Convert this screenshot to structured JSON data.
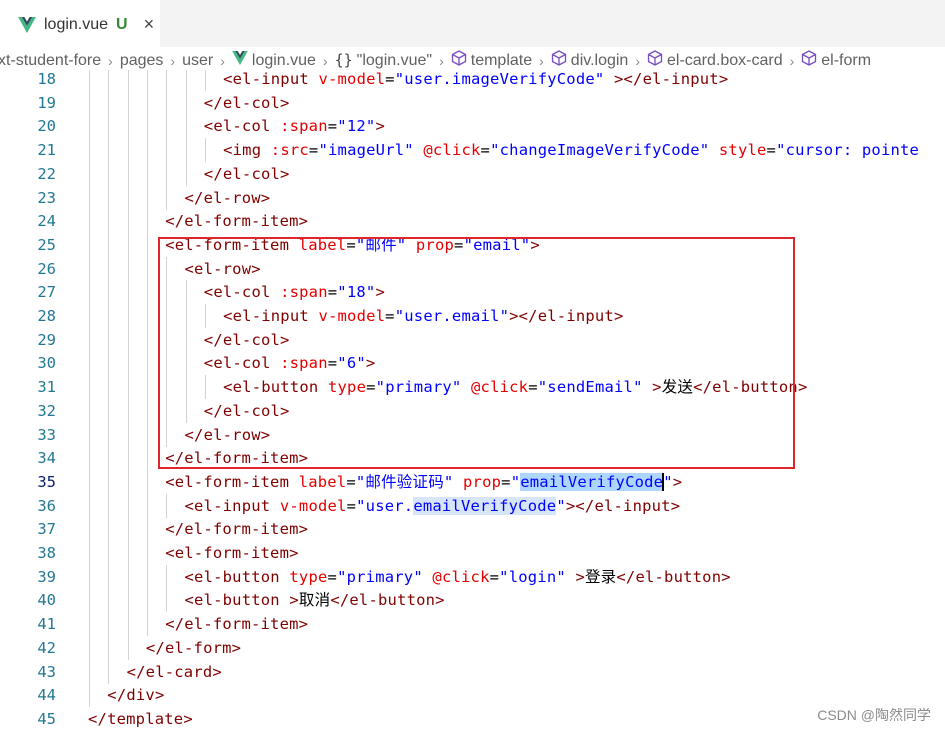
{
  "tab": {
    "title": "login.vue",
    "status": "U",
    "close": "×",
    "icon": "vue-icon"
  },
  "breadcrumb": [
    {
      "label": "xt-student-fore",
      "icon": ""
    },
    {
      "label": "pages",
      "icon": ""
    },
    {
      "label": "user",
      "icon": ""
    },
    {
      "label": "login.vue",
      "icon": "vue-icon"
    },
    {
      "label": "\"login.vue\"",
      "icon": "braces-icon"
    },
    {
      "label": "template",
      "icon": "cube-icon"
    },
    {
      "label": "div.login",
      "icon": "cube-icon"
    },
    {
      "label": "el-card.box-card",
      "icon": "cube-icon"
    },
    {
      "label": "el-form",
      "icon": "cube-icon"
    }
  ],
  "colors": {
    "tag": "#800000",
    "attr": "#e50000",
    "string": "#0000ff",
    "line_number": "#237893",
    "highlight": "#add6ff",
    "annotation_box": "#e1262b"
  },
  "active_line": "35",
  "lines": [
    {
      "n": "18",
      "indent": 7,
      "tokens": [
        {
          "t": "tag",
          "v": "<el-input"
        },
        {
          "t": "text",
          "v": " "
        },
        {
          "t": "attr",
          "v": "v-model"
        },
        {
          "t": "text",
          "v": "="
        },
        {
          "t": "str",
          "v": "\"user.imageVerifyCode\""
        },
        {
          "t": "text",
          "v": " "
        },
        {
          "t": "tag",
          "v": "></el-input>"
        }
      ]
    },
    {
      "n": "19",
      "indent": 6,
      "tokens": [
        {
          "t": "tag",
          "v": "</el-col>"
        }
      ]
    },
    {
      "n": "20",
      "indent": 6,
      "tokens": [
        {
          "t": "tag",
          "v": "<el-col"
        },
        {
          "t": "text",
          "v": " "
        },
        {
          "t": "attr",
          "v": ":span"
        },
        {
          "t": "text",
          "v": "="
        },
        {
          "t": "str",
          "v": "\"12\""
        },
        {
          "t": "tag",
          "v": ">"
        }
      ]
    },
    {
      "n": "21",
      "indent": 7,
      "tokens": [
        {
          "t": "tag",
          "v": "<img"
        },
        {
          "t": "text",
          "v": " "
        },
        {
          "t": "attr",
          "v": ":src"
        },
        {
          "t": "text",
          "v": "="
        },
        {
          "t": "str",
          "v": "\"imageUrl\""
        },
        {
          "t": "text",
          "v": " "
        },
        {
          "t": "attr",
          "v": "@click"
        },
        {
          "t": "text",
          "v": "="
        },
        {
          "t": "str",
          "v": "\"changeImageVerifyCode\""
        },
        {
          "t": "text",
          "v": " "
        },
        {
          "t": "attr",
          "v": "style"
        },
        {
          "t": "text",
          "v": "="
        },
        {
          "t": "str",
          "v": "\"cursor: pointe"
        }
      ]
    },
    {
      "n": "22",
      "indent": 6,
      "tokens": [
        {
          "t": "tag",
          "v": "</el-col>"
        }
      ]
    },
    {
      "n": "23",
      "indent": 5,
      "tokens": [
        {
          "t": "tag",
          "v": "</el-row>"
        }
      ]
    },
    {
      "n": "24",
      "indent": 4,
      "tokens": [
        {
          "t": "tag",
          "v": "</el-form-item>"
        }
      ]
    },
    {
      "n": "25",
      "indent": 4,
      "tokens": [
        {
          "t": "tag",
          "v": "<el-form-item"
        },
        {
          "t": "text",
          "v": " "
        },
        {
          "t": "attr",
          "v": "label"
        },
        {
          "t": "text",
          "v": "="
        },
        {
          "t": "str",
          "v": "\"邮件\""
        },
        {
          "t": "text",
          "v": " "
        },
        {
          "t": "attr",
          "v": "prop"
        },
        {
          "t": "text",
          "v": "="
        },
        {
          "t": "str",
          "v": "\"email\""
        },
        {
          "t": "tag",
          "v": ">"
        }
      ]
    },
    {
      "n": "26",
      "indent": 5,
      "tokens": [
        {
          "t": "tag",
          "v": "<el-row>"
        }
      ]
    },
    {
      "n": "27",
      "indent": 6,
      "tokens": [
        {
          "t": "tag",
          "v": "<el-col"
        },
        {
          "t": "text",
          "v": " "
        },
        {
          "t": "attr",
          "v": ":span"
        },
        {
          "t": "text",
          "v": "="
        },
        {
          "t": "str",
          "v": "\"18\""
        },
        {
          "t": "tag",
          "v": ">"
        }
      ]
    },
    {
      "n": "28",
      "indent": 7,
      "tokens": [
        {
          "t": "tag",
          "v": "<el-input"
        },
        {
          "t": "text",
          "v": " "
        },
        {
          "t": "attr",
          "v": "v-model"
        },
        {
          "t": "text",
          "v": "="
        },
        {
          "t": "str",
          "v": "\"user.email\""
        },
        {
          "t": "tag",
          "v": "></el-input>"
        }
      ]
    },
    {
      "n": "29",
      "indent": 6,
      "tokens": [
        {
          "t": "tag",
          "v": "</el-col>"
        }
      ]
    },
    {
      "n": "30",
      "indent": 6,
      "tokens": [
        {
          "t": "tag",
          "v": "<el-col"
        },
        {
          "t": "text",
          "v": " "
        },
        {
          "t": "attr",
          "v": ":span"
        },
        {
          "t": "text",
          "v": "="
        },
        {
          "t": "str",
          "v": "\"6\""
        },
        {
          "t": "tag",
          "v": ">"
        }
      ]
    },
    {
      "n": "31",
      "indent": 7,
      "tokens": [
        {
          "t": "tag",
          "v": "<el-button"
        },
        {
          "t": "text",
          "v": " "
        },
        {
          "t": "attr",
          "v": "type"
        },
        {
          "t": "text",
          "v": "="
        },
        {
          "t": "str",
          "v": "\"primary\""
        },
        {
          "t": "text",
          "v": " "
        },
        {
          "t": "attr",
          "v": "@click"
        },
        {
          "t": "text",
          "v": "="
        },
        {
          "t": "str",
          "v": "\"sendEmail\""
        },
        {
          "t": "text",
          "v": " "
        },
        {
          "t": "tag",
          "v": ">"
        },
        {
          "t": "text",
          "v": "发送"
        },
        {
          "t": "tag",
          "v": "</el-button>"
        }
      ]
    },
    {
      "n": "32",
      "indent": 6,
      "tokens": [
        {
          "t": "tag",
          "v": "</el-col>"
        }
      ]
    },
    {
      "n": "33",
      "indent": 5,
      "tokens": [
        {
          "t": "tag",
          "v": "</el-row>"
        }
      ]
    },
    {
      "n": "34",
      "indent": 4,
      "tokens": [
        {
          "t": "tag",
          "v": "</el-form-item>"
        }
      ]
    },
    {
      "n": "35",
      "indent": 4,
      "tokens": [
        {
          "t": "tag",
          "v": "<el-form-item"
        },
        {
          "t": "text",
          "v": " "
        },
        {
          "t": "attr",
          "v": "label"
        },
        {
          "t": "text",
          "v": "="
        },
        {
          "t": "str",
          "v": "\"邮件验证码\""
        },
        {
          "t": "text",
          "v": " "
        },
        {
          "t": "attr",
          "v": "prop"
        },
        {
          "t": "text",
          "v": "="
        },
        {
          "t": "str",
          "v": "\""
        },
        {
          "t": "strhl",
          "v": "emailVerifyCode"
        },
        {
          "t": "cursor",
          "v": ""
        },
        {
          "t": "str",
          "v": "\""
        },
        {
          "t": "tag",
          "v": ">"
        }
      ]
    },
    {
      "n": "36",
      "indent": 5,
      "tokens": [
        {
          "t": "tag",
          "v": "<el-input"
        },
        {
          "t": "text",
          "v": " "
        },
        {
          "t": "attr",
          "v": "v-model"
        },
        {
          "t": "text",
          "v": "="
        },
        {
          "t": "str",
          "v": "\"user."
        },
        {
          "t": "strhl2",
          "v": "emailVerifyCode"
        },
        {
          "t": "str",
          "v": "\""
        },
        {
          "t": "tag",
          "v": "></el-input>"
        }
      ]
    },
    {
      "n": "37",
      "indent": 4,
      "tokens": [
        {
          "t": "tag",
          "v": "</el-form-item>"
        }
      ]
    },
    {
      "n": "38",
      "indent": 4,
      "tokens": [
        {
          "t": "tag",
          "v": "<el-form-item>"
        }
      ]
    },
    {
      "n": "39",
      "indent": 5,
      "tokens": [
        {
          "t": "tag",
          "v": "<el-button"
        },
        {
          "t": "text",
          "v": " "
        },
        {
          "t": "attr",
          "v": "type"
        },
        {
          "t": "text",
          "v": "="
        },
        {
          "t": "str",
          "v": "\"primary\""
        },
        {
          "t": "text",
          "v": " "
        },
        {
          "t": "attr",
          "v": "@click"
        },
        {
          "t": "text",
          "v": "="
        },
        {
          "t": "str",
          "v": "\"login\""
        },
        {
          "t": "text",
          "v": " "
        },
        {
          "t": "tag",
          "v": ">"
        },
        {
          "t": "text",
          "v": "登录"
        },
        {
          "t": "tag",
          "v": "</el-button>"
        }
      ]
    },
    {
      "n": "40",
      "indent": 5,
      "tokens": [
        {
          "t": "tag",
          "v": "<el-button"
        },
        {
          "t": "text",
          "v": " "
        },
        {
          "t": "tag",
          "v": ">"
        },
        {
          "t": "text",
          "v": "取消"
        },
        {
          "t": "tag",
          "v": "</el-button>"
        }
      ]
    },
    {
      "n": "41",
      "indent": 4,
      "tokens": [
        {
          "t": "tag",
          "v": "</el-form-item>"
        }
      ]
    },
    {
      "n": "42",
      "indent": 3,
      "tokens": [
        {
          "t": "tag",
          "v": "</el-form>"
        }
      ]
    },
    {
      "n": "43",
      "indent": 2,
      "tokens": [
        {
          "t": "tag",
          "v": "</el-card>"
        }
      ]
    },
    {
      "n": "44",
      "indent": 1,
      "tokens": [
        {
          "t": "tag",
          "v": "</div>"
        }
      ]
    },
    {
      "n": "45",
      "indent": 0,
      "tokens": [
        {
          "t": "tag",
          "v": "</template>"
        }
      ]
    }
  ],
  "watermark": "CSDN @陶然同学"
}
